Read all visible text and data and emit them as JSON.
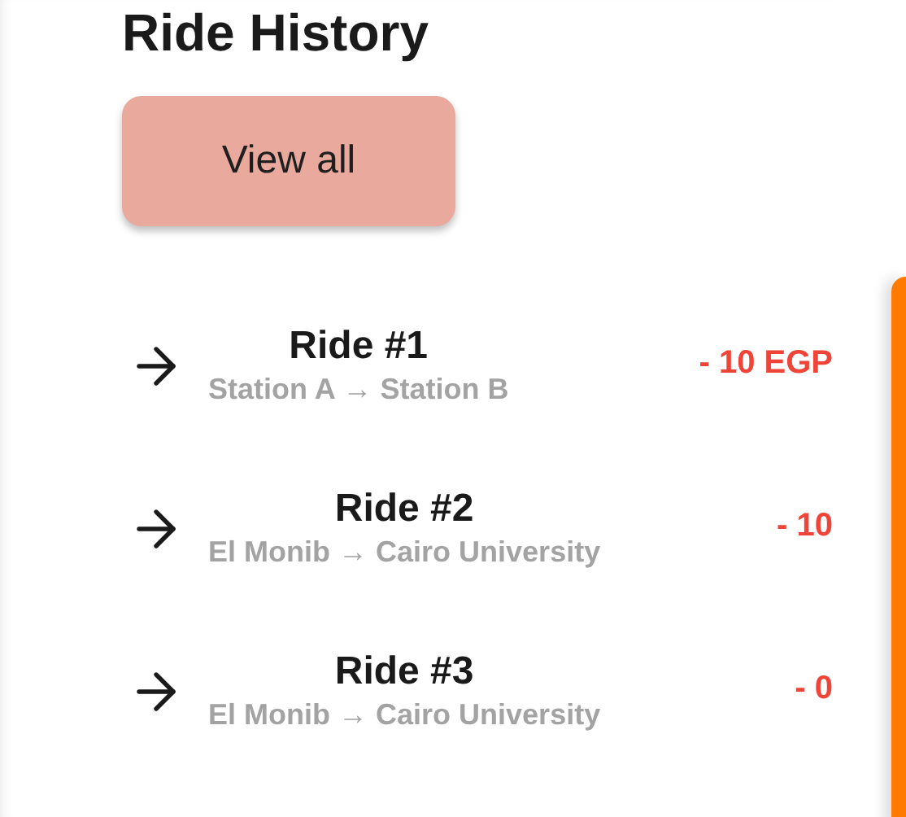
{
  "title": "Ride History",
  "view_all_button": "View all",
  "rides": [
    {
      "title": "Ride #1",
      "from": "Station A",
      "arrow": "→",
      "to": "Station B",
      "amount": "- 10 EGP"
    },
    {
      "title": "Ride #2",
      "from": "El Monib",
      "arrow": "→",
      "to": "Cairo University",
      "amount": "- 10"
    },
    {
      "title": "Ride #3",
      "from": "El Monib",
      "arrow": "→",
      "to": "Cairo University",
      "amount": "- 0"
    }
  ]
}
